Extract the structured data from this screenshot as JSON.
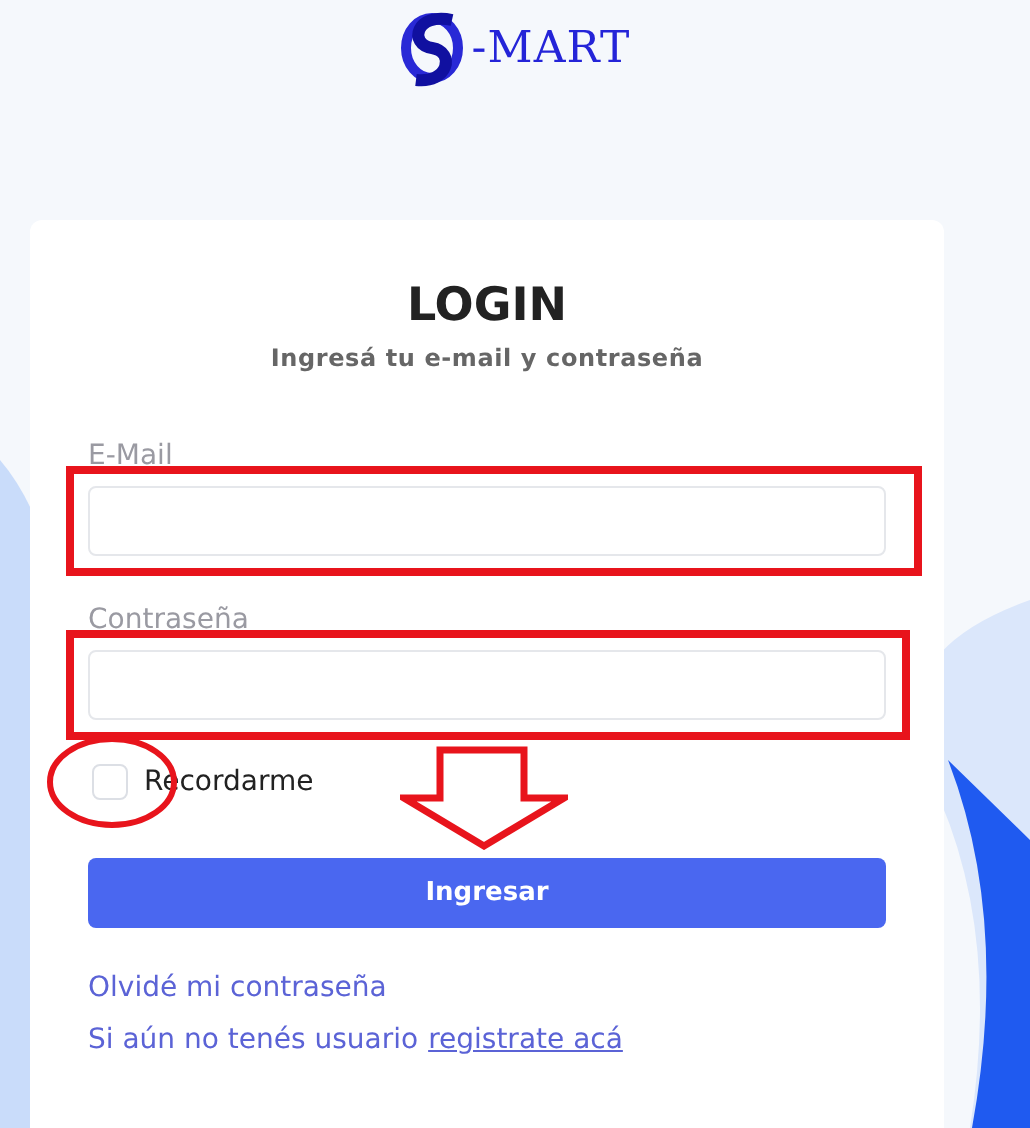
{
  "logo": {
    "text": "-MART"
  },
  "login": {
    "title": "LOGIN",
    "subtitle": "Ingresá tu e-mail y contraseña",
    "fields": [
      {
        "label": "E-Mail",
        "highlighted": true
      },
      {
        "label": "Contraseña",
        "highlighted": true
      }
    ],
    "remember": {
      "label": "Recordarme",
      "checked": false,
      "circled": true
    },
    "submit": {
      "label": "Ingresar",
      "arrow_marked": true
    },
    "forgot_link": "Olvidé mi contraseña",
    "register": {
      "text": "Si aún no tenés usuario",
      "link": "registrate acá"
    }
  }
}
